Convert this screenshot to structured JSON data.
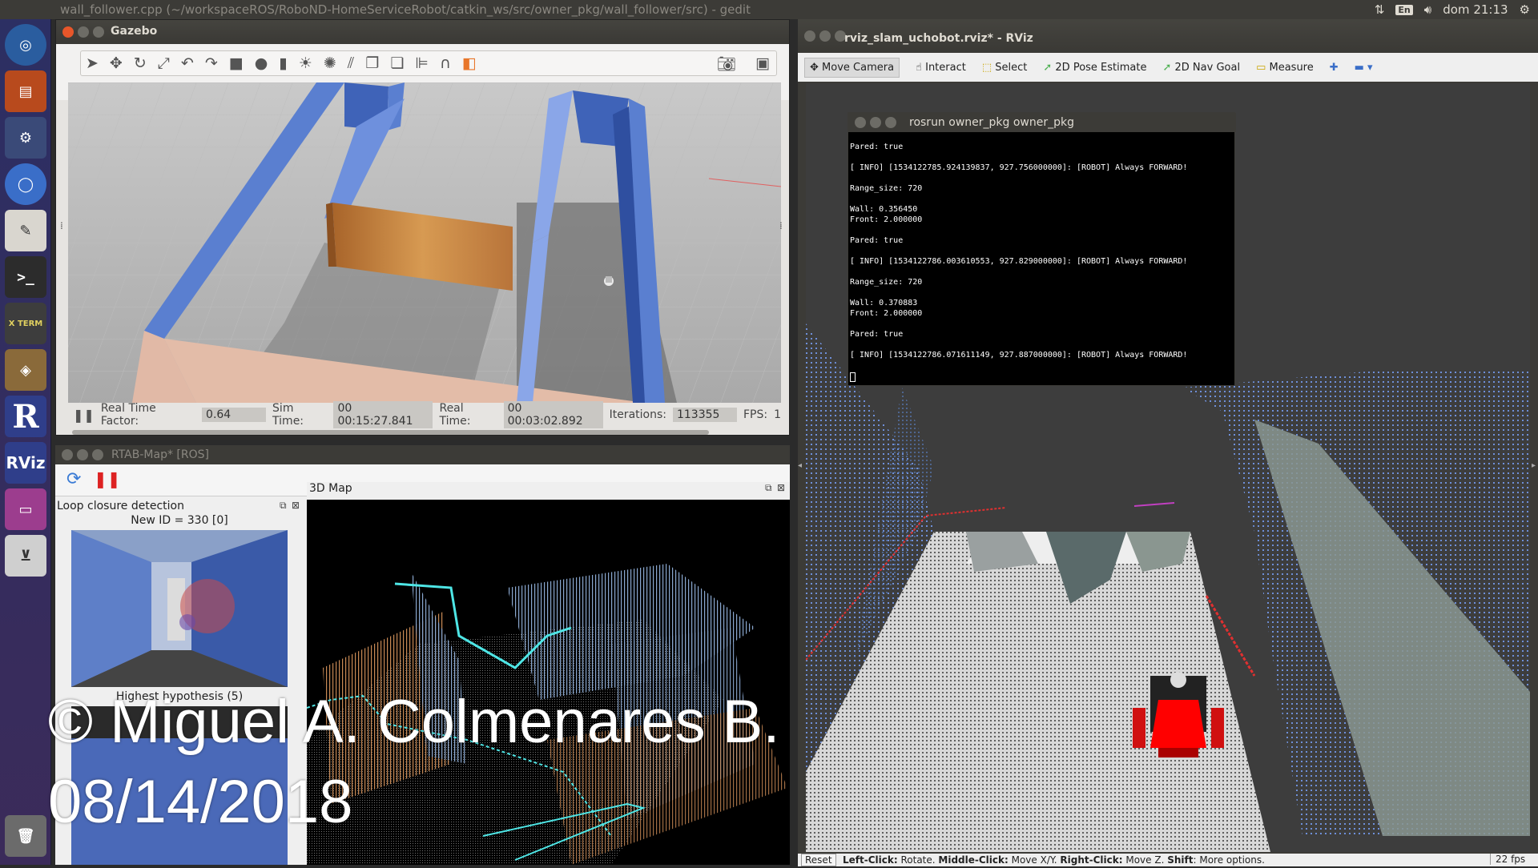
{
  "topbar": {
    "title": "wall_follower.cpp (~/workspaceROS/RoboND-HomeServiceRobot/catkin_ws/src/owner_pkg/wall_follower/src) - gedit",
    "lang": "En",
    "clock": "dom 21:13"
  },
  "launcher": {
    "items": [
      "ubuntu-icon",
      "files-icon",
      "settings-icon",
      "chromium-icon",
      "text-editor-icon",
      "terminal-icon",
      "xterm-icon",
      "virtualbox-icon",
      "rstudio-icon",
      "rviz-icon",
      "workspace-icon",
      "scanner-icon",
      "trash-icon"
    ],
    "xterm_label": "X TERM",
    "rviz_label": "RViz",
    "r_label": "R"
  },
  "gazebo": {
    "title": "Gazebo",
    "status": {
      "rtf_label": "Real Time Factor:",
      "rtf_value": "0.64",
      "sim_label": "Sim Time:",
      "sim_value": "00 00:15:27.841",
      "real_label": "Real Time:",
      "real_value": "00 00:03:02.892",
      "iter_label": "Iterations:",
      "iter_value": "113355",
      "fps_label": "FPS:",
      "fps_value": "1"
    }
  },
  "rtab": {
    "title": "RTAB-Map* [ROS]",
    "loop_title": "Loop closure detection",
    "new_id": "New ID = 330 [0]",
    "highest": "Highest hypothesis (5)",
    "map_title": "3D Map"
  },
  "rviz": {
    "title": "rviz_slam_uchobot.rviz* - RViz",
    "tools": [
      "Move Camera",
      "Interact",
      "Select",
      "2D Pose Estimate",
      "2D Nav Goal",
      "Measure"
    ],
    "status_reset": "Reset",
    "status_help_1": "Left-Click:",
    "status_help_1b": " Rotate. ",
    "status_help_2": "Middle-Click:",
    "status_help_2b": " Move X/Y. ",
    "status_help_3": "Right-Click:",
    "status_help_3b": " Move Z. ",
    "status_help_4": "Shift",
    "status_help_4b": ": More options.",
    "fps": "22 fps"
  },
  "terminal": {
    "title": "rosrun owner_pkg owner_pkg",
    "lines": [
      "Pared: true",
      "",
      "[ INFO] [1534122785.924139837, 927.756000000]: [ROBOT] Always FORWARD!",
      "",
      "Range_size: 720",
      "",
      "Wall: 0.356450",
      "Front: 2.000000",
      "",
      "Pared: true",
      "",
      "[ INFO] [1534122786.003610553, 927.829000000]: [ROBOT] Always FORWARD!",
      "",
      "Range_size: 720",
      "",
      "Wall: 0.370883",
      "Front: 2.000000",
      "",
      "Pared: true",
      "",
      "[ INFO] [1534122786.071611149, 927.887000000]: [ROBOT] Always FORWARD!",
      ""
    ]
  },
  "watermark": {
    "line1": "© Miguel A. Colmenares B.",
    "line2": "08/14/2018"
  }
}
